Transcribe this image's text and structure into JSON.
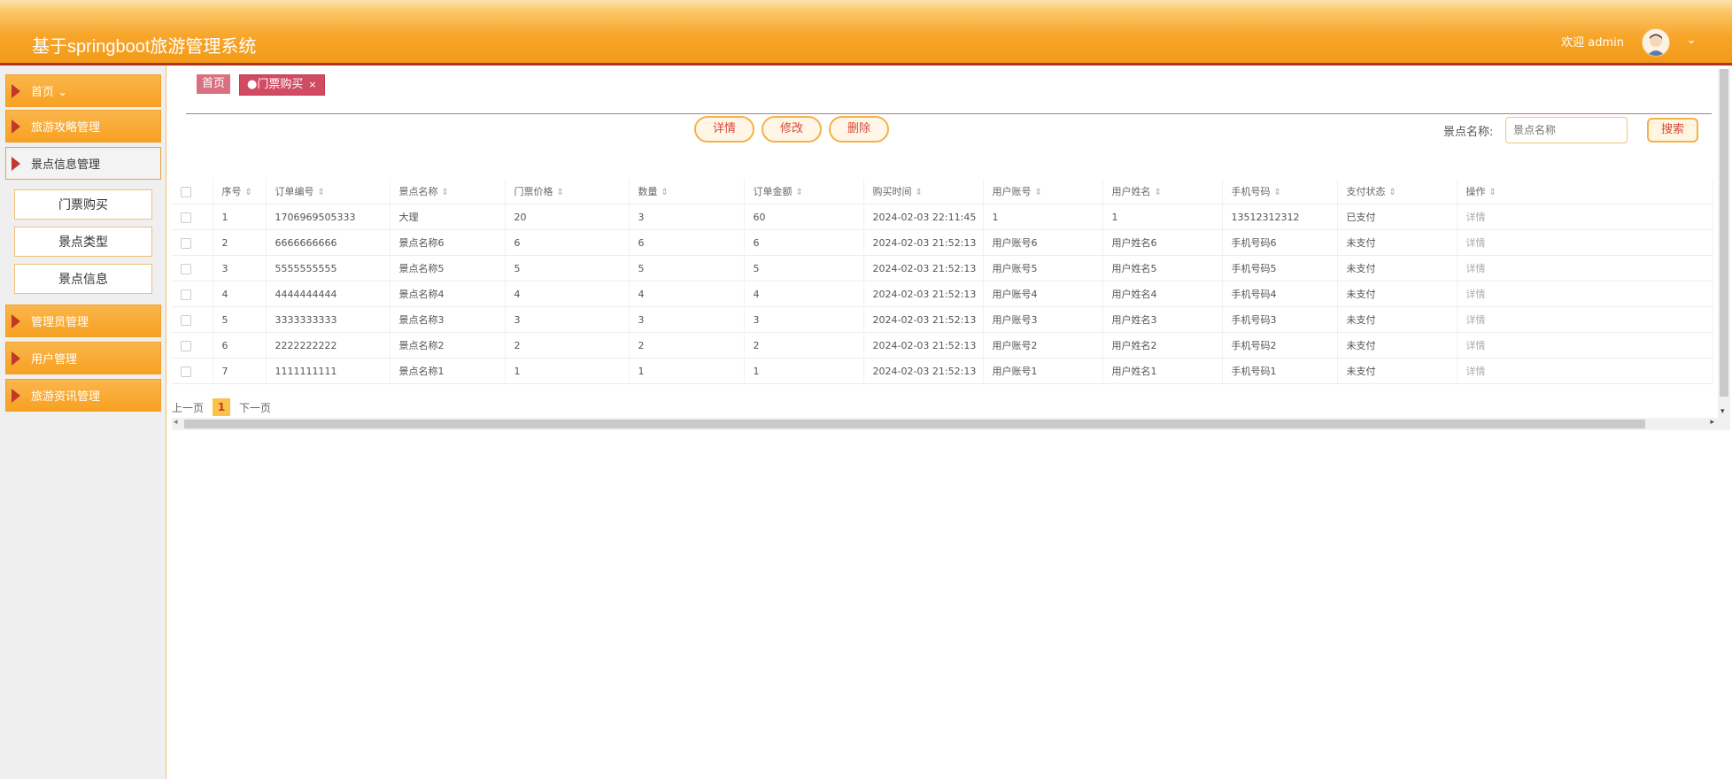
{
  "header": {
    "title": "基于springboot旅游管理系统",
    "welcome": "欢迎 admin",
    "avatar_icon": "user-avatar-icon",
    "caret": "⌄"
  },
  "sidebar": {
    "items": [
      {
        "label": "首页 ⌄"
      },
      {
        "label": "旅游攻略管理"
      },
      {
        "label": "景点信息管理"
      },
      {
        "label": "管理员管理"
      },
      {
        "label": "用户管理"
      },
      {
        "label": "旅游资讯管理"
      }
    ],
    "subitems": [
      {
        "label": "门票购买"
      },
      {
        "label": "景点类型"
      },
      {
        "label": "景点信息"
      }
    ]
  },
  "tabs": {
    "home": "首页",
    "active": "●门票购买",
    "close": "×"
  },
  "toolbar": {
    "detail": "详情",
    "edit": "修改",
    "delete": "删除",
    "search_label": "景点名称:",
    "search_placeholder": "景点名称",
    "search_button": "搜索"
  },
  "table": {
    "headers": [
      "序号",
      "订单编号",
      "景点名称",
      "门票价格",
      "数量",
      "订单金额",
      "购买时间",
      "用户账号",
      "用户姓名",
      "手机号码",
      "支付状态",
      "操作"
    ],
    "rows": [
      [
        "1",
        "1706969505333",
        "大理",
        "20",
        "3",
        "60",
        "2024-02-03 22:11:45",
        "1",
        "1",
        "13512312312",
        "已支付",
        "详情"
      ],
      [
        "2",
        "6666666666",
        "景点名称6",
        "6",
        "6",
        "6",
        "2024-02-03 21:52:13",
        "用户账号6",
        "用户姓名6",
        "手机号码6",
        "未支付",
        "详情"
      ],
      [
        "3",
        "5555555555",
        "景点名称5",
        "5",
        "5",
        "5",
        "2024-02-03 21:52:13",
        "用户账号5",
        "用户姓名5",
        "手机号码5",
        "未支付",
        "详情"
      ],
      [
        "4",
        "4444444444",
        "景点名称4",
        "4",
        "4",
        "4",
        "2024-02-03 21:52:13",
        "用户账号4",
        "用户姓名4",
        "手机号码4",
        "未支付",
        "详情"
      ],
      [
        "5",
        "3333333333",
        "景点名称3",
        "3",
        "3",
        "3",
        "2024-02-03 21:52:13",
        "用户账号3",
        "用户姓名3",
        "手机号码3",
        "未支付",
        "详情"
      ],
      [
        "6",
        "2222222222",
        "景点名称2",
        "2",
        "2",
        "2",
        "2024-02-03 21:52:13",
        "用户账号2",
        "用户姓名2",
        "手机号码2",
        "未支付",
        "详情"
      ],
      [
        "7",
        "1111111111",
        "景点名称1",
        "1",
        "1",
        "1",
        "2024-02-03 21:52:13",
        "用户账号1",
        "用户姓名1",
        "手机号码1",
        "未支付",
        "详情"
      ]
    ]
  },
  "pagination": {
    "prev": "上一页",
    "current": "1",
    "next": "下一页"
  },
  "colors": {
    "header_orange": "#f7a122",
    "accent_red": "#d6483a",
    "tab_pink": "#d14b63"
  }
}
